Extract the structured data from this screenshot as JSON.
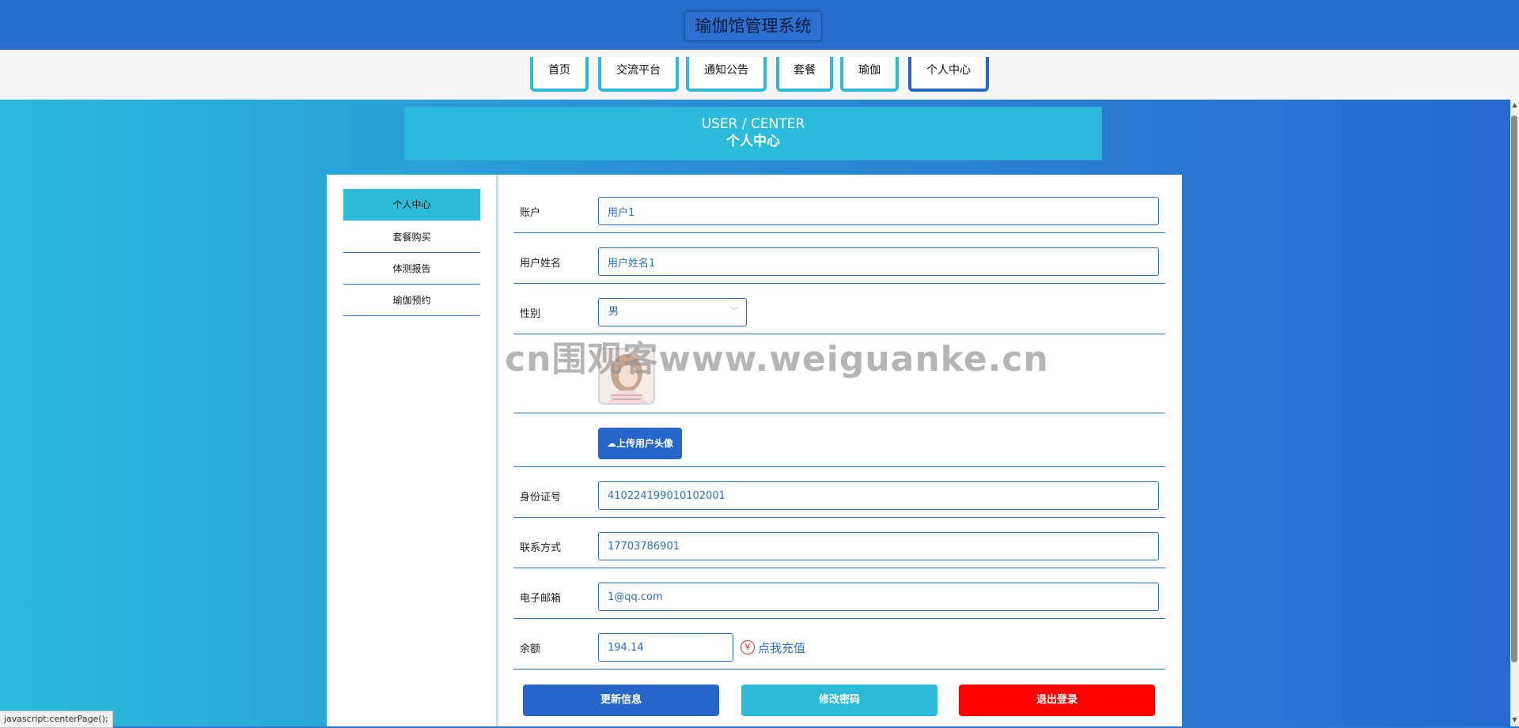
{
  "header": {
    "title": "瑜伽馆管理系统"
  },
  "nav": {
    "items": [
      {
        "label": "首页"
      },
      {
        "label": "交流平台"
      },
      {
        "label": "通知公告"
      },
      {
        "label": "套餐"
      },
      {
        "label": "瑜伽"
      },
      {
        "label": "个人中心"
      }
    ],
    "active_index": 5
  },
  "banner": {
    "en": "USER / CENTER",
    "cn": "个人中心"
  },
  "sidebar": {
    "items": [
      {
        "label": "个人中心"
      },
      {
        "label": "套餐购买"
      },
      {
        "label": "体测报告"
      },
      {
        "label": "瑜伽预约"
      }
    ],
    "active_index": 0
  },
  "form": {
    "account": {
      "label": "账户",
      "value": "用户1"
    },
    "username": {
      "label": "用户姓名",
      "value": "用户姓名1"
    },
    "gender": {
      "label": "性别",
      "value": "男"
    },
    "avatar_icon": "avatar-image",
    "upload_label": "上传用户头像",
    "id_number": {
      "label": "身份证号",
      "value": "410224199010102001"
    },
    "phone": {
      "label": "联系方式",
      "value": "17703786901"
    },
    "email": {
      "label": "电子邮箱",
      "value": "1@qq.com"
    },
    "balance": {
      "label": "余额",
      "value": "194.14",
      "recharge_label": "点我充值",
      "yen_symbol": "¥"
    }
  },
  "actions": {
    "update_label": "更新信息",
    "password_label": "修改密码",
    "logout_label": "退出登录",
    "update_color": "#2666c9",
    "password_color": "#2bbbd8",
    "logout_color": "#ff0000"
  },
  "watermark": "cn围观客www.weiguanke.cn",
  "statusbar": "javascript:centerPage();"
}
